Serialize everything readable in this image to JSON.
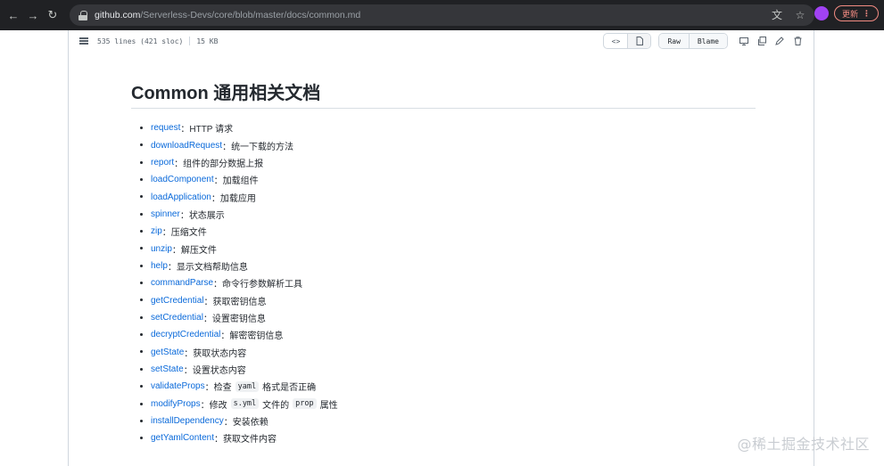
{
  "browser": {
    "url_host": "github.com",
    "url_path": "/Serverless-Devs/core/blob/master/docs/common.md",
    "profile_label": "",
    "update_label": "更新",
    "icons": {
      "back": "back-arrow-icon",
      "forward": "forward-arrow-icon",
      "reload": "reload-icon",
      "lock": "lock-icon",
      "translate": "translate-icon",
      "bookmark": "star-icon",
      "menu": "kebab-menu-icon"
    }
  },
  "file": {
    "lines": "535 lines (421 sloc)",
    "size": "15 KB",
    "raw_label": "Raw",
    "blame_label": "Blame"
  },
  "markdown": {
    "title": "Common 通用相关文档",
    "separator": "：",
    "items": [
      {
        "link": "request",
        "desc": "HTTP 请求"
      },
      {
        "link": "downloadRequest",
        "desc": "统一下载的方法"
      },
      {
        "link": "report",
        "desc": "组件的部分数据上报"
      },
      {
        "link": "loadComponent",
        "desc": "加载组件"
      },
      {
        "link": "loadApplication",
        "desc": "加载应用"
      },
      {
        "link": "spinner",
        "desc": "状态展示"
      },
      {
        "link": "zip",
        "desc": "压缩文件"
      },
      {
        "link": "unzip",
        "desc": "解压文件"
      },
      {
        "link": "help",
        "desc": "显示文档帮助信息"
      },
      {
        "link": "commandParse",
        "desc": "命令行参数解析工具"
      },
      {
        "link": "getCredential",
        "desc": "获取密钥信息"
      },
      {
        "link": "setCredential",
        "desc": "设置密钥信息"
      },
      {
        "link": "decryptCredential",
        "desc": "解密密钥信息"
      },
      {
        "link": "getState",
        "desc": "获取状态内容"
      },
      {
        "link": "setState",
        "desc": "设置状态内容"
      },
      {
        "link": "validateProps",
        "desc_pre": "检查",
        "code1": "yaml",
        "desc_post": "格式是否正确"
      },
      {
        "link": "modifyProps",
        "desc_pre": "修改",
        "code1": "s.yml",
        "desc_mid": "文件的",
        "code2": "prop",
        "desc_post": "属性"
      },
      {
        "link": "installDependency",
        "desc": "安装依赖"
      },
      {
        "link": "getYamlContent",
        "desc": "获取文件内容"
      }
    ]
  },
  "watermark": "@稀土掘金技术社区",
  "colors": {
    "link": "#0969da",
    "chrome_bg": "#202124",
    "update_accent": "#f28b82"
  }
}
